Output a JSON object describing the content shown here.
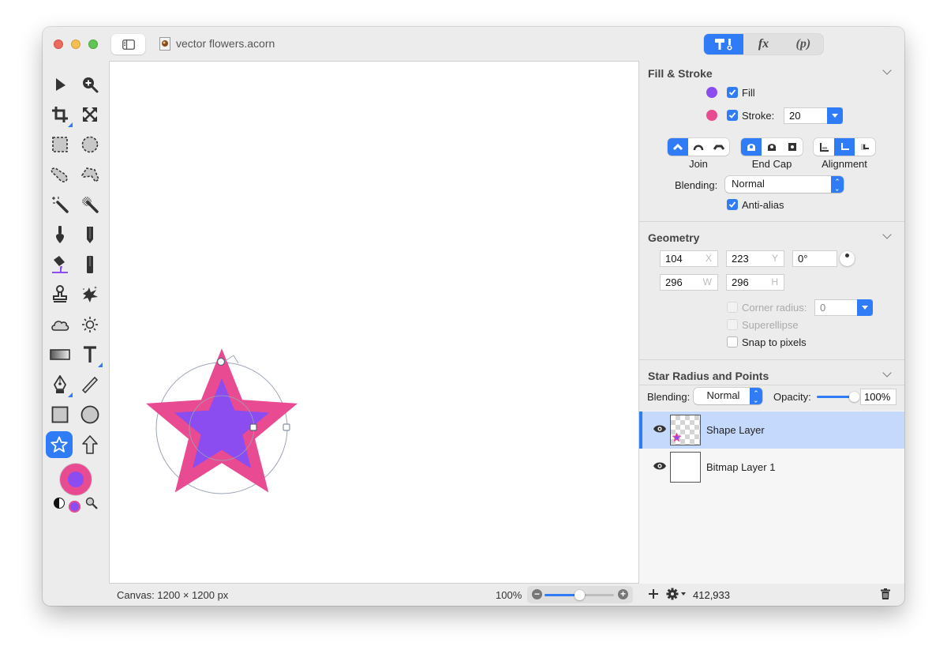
{
  "window": {
    "title": "vector flowers.acorn",
    "inspector_tabs": [
      {
        "name": "tool-options",
        "icon": "hammer-brush-icon",
        "label": "",
        "active": true
      },
      {
        "name": "filters",
        "icon": "fx-icon",
        "label": "fx",
        "active": false
      },
      {
        "name": "properties",
        "icon": "p-icon",
        "label": "(p)",
        "active": false
      }
    ]
  },
  "colors": {
    "accent": "#2f7cf6",
    "fill": "#8b4cf0",
    "stroke": "#e94b92",
    "selection_row": "#c4d9fb"
  },
  "toolbox": {
    "tools": [
      {
        "id": "move",
        "icon": "arrow-pointer-icon"
      },
      {
        "id": "zoom",
        "icon": "zoom-in-icon"
      },
      {
        "id": "crop",
        "icon": "crop-icon"
      },
      {
        "id": "transform",
        "icon": "expand-arrows-icon"
      },
      {
        "id": "rect-select",
        "icon": "rect-select-icon"
      },
      {
        "id": "ellipse-select",
        "icon": "ellipse-select-icon"
      },
      {
        "id": "lasso",
        "icon": "lasso-icon"
      },
      {
        "id": "polygon-lasso",
        "icon": "polygon-lasso-icon"
      },
      {
        "id": "magic-wand",
        "icon": "magic-wand-icon"
      },
      {
        "id": "color-select",
        "icon": "color-wand-icon"
      },
      {
        "id": "brush",
        "icon": "brush-icon"
      },
      {
        "id": "pencil",
        "icon": "pencil-icon"
      },
      {
        "id": "paint-bucket",
        "icon": "paint-bucket-icon"
      },
      {
        "id": "eraser",
        "icon": "eraser-icon"
      },
      {
        "id": "clone-stamp",
        "icon": "stamp-icon"
      },
      {
        "id": "smudge",
        "icon": "splatter-icon"
      },
      {
        "id": "burn",
        "icon": "cloud-icon"
      },
      {
        "id": "dodge",
        "icon": "sun-icon"
      },
      {
        "id": "gradient",
        "icon": "gradient-icon"
      },
      {
        "id": "text",
        "icon": "text-icon"
      },
      {
        "id": "bezier",
        "icon": "pen-nib-icon"
      },
      {
        "id": "line",
        "icon": "line-icon"
      },
      {
        "id": "rectangle",
        "icon": "rectangle-icon"
      },
      {
        "id": "oval",
        "icon": "oval-icon"
      },
      {
        "id": "star",
        "icon": "star-icon",
        "selected": true
      },
      {
        "id": "arrow",
        "icon": "up-arrow-icon"
      }
    ]
  },
  "canvas": {
    "status": "Canvas: 1200 × 1200 px",
    "zoom_label": "100%",
    "zoom_slider_fraction": 0.5
  },
  "fill_stroke": {
    "title": "Fill & Stroke",
    "fill_label": "Fill",
    "fill_checked": true,
    "stroke_label": "Stroke:",
    "stroke_checked": true,
    "stroke_width": "20",
    "join_label": "Join",
    "join_options": [
      "miter",
      "round",
      "bevel"
    ],
    "join_selected": "miter",
    "endcap_label": "End Cap",
    "endcap_options": [
      "butt",
      "round",
      "square"
    ],
    "endcap_selected": "butt",
    "alignment_label": "Alignment",
    "alignment_options": [
      "inside",
      "center",
      "outside"
    ],
    "alignment_selected": "center",
    "blending_label": "Blending:",
    "blending_value": "Normal",
    "antialias_label": "Anti-alias",
    "antialias_checked": true
  },
  "geometry": {
    "title": "Geometry",
    "x": "104",
    "x_unit": "X",
    "y": "223",
    "y_unit": "Y",
    "rotation": "0°",
    "w": "296",
    "w_unit": "W",
    "h": "296",
    "h_unit": "H",
    "corner_radius_label": "Corner radius:",
    "corner_radius_value": "0",
    "corner_radius_checked": false,
    "superellipse_label": "Superellipse",
    "superellipse_checked": false,
    "snap_label": "Snap to pixels",
    "snap_checked": false
  },
  "star_section": {
    "title": "Star Radius and Points"
  },
  "layers": {
    "blending_label": "Blending:",
    "blending_value": "Normal",
    "opacity_label": "Opacity:",
    "opacity_value": "100%",
    "opacity_fraction": 1.0,
    "items": [
      {
        "name": "Shape Layer",
        "visible": true,
        "selected": true
      },
      {
        "name": "Bitmap Layer 1",
        "visible": true,
        "selected": false
      }
    ],
    "footer_count": "412,933"
  }
}
